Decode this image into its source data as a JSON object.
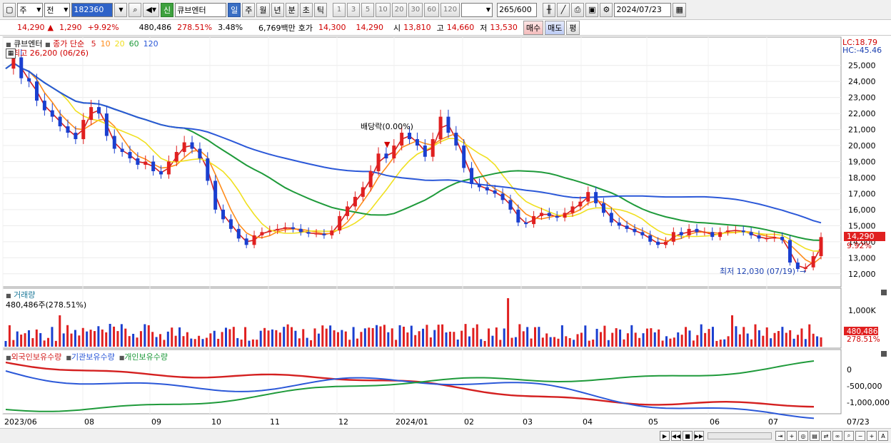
{
  "toolbar": {
    "type_select": "주",
    "prev_label": "전",
    "code_value": "182360",
    "search_icon": "magnifier-icon",
    "credit_badge": "신",
    "stock_name": "큐브엔터",
    "period_tabs": [
      "일",
      "주",
      "월",
      "년",
      "분",
      "초",
      "틱"
    ],
    "active_period": "일",
    "interval_buttons": [
      "1",
      "3",
      "5",
      "10",
      "20",
      "30",
      "60",
      "120"
    ],
    "count_value": "265",
    "count_total": "/600",
    "date_value": "2024/07/23"
  },
  "quote": {
    "price": "14,290",
    "change_arrow": "▲",
    "change": "1,290",
    "change_pct": "+9.92%",
    "volume": "480,486",
    "volume_ratio": "278.51%",
    "turnover": "3.48%",
    "amount": "6,769백만",
    "bid_ask_label": "호가",
    "ask": "14,300",
    "bid": "14,290",
    "open_label": "시",
    "open": "13,810",
    "high_label": "고",
    "high": "14,660",
    "low_label": "저",
    "low": "13,530",
    "buy_button": "매수",
    "sell_button": "매도",
    "eval_button": "평"
  },
  "price_panel": {
    "legend_name": "큐브엔터",
    "legend_close": "종가 단순",
    "ma_labels": [
      "5",
      "10",
      "20",
      "60",
      "120"
    ],
    "ma_colors": [
      "#d42020",
      "#ff8c1a",
      "#f0e020",
      "#1e9a3a",
      "#2b58d8"
    ],
    "high_note": "최고 26,200 (06/26)",
    "low_note": "최저 12,030 (07/19)",
    "dividend_note": "배당락(0.00%)",
    "lc": "LC:18.79",
    "hc": "HC:-45.46",
    "current_price_tag": "14,290",
    "current_pct_tag": "9.92%"
  },
  "volume_panel": {
    "title": "거래량",
    "value": "480,486주(278.51%)",
    "tag_value": "480,486",
    "tag_pct": "278.51%",
    "axis_label": "1,000K"
  },
  "holder_panel": {
    "legend": [
      "외국인보유수량",
      "기관보유수량",
      "개인보유수량"
    ],
    "legend_colors": [
      "#d42020",
      "#2b58d8",
      "#1e9a3a"
    ],
    "axis_labels": [
      "0",
      "-500,000",
      "-1,000,000"
    ]
  },
  "x_axis": {
    "labels": [
      "2023/06",
      "08",
      "09",
      "10",
      "11",
      "12",
      "2024/01",
      "02",
      "03",
      "04",
      "05",
      "06",
      "07"
    ],
    "right_label": "07/23"
  },
  "chart_data": {
    "type": "line",
    "y_axis_labels": [
      "25,000",
      "24,000",
      "23,000",
      "22,000",
      "21,000",
      "20,000",
      "19,000",
      "18,000",
      "17,000",
      "16,000",
      "15,000",
      "14,000",
      "13,000",
      "12,000"
    ],
    "ylim": [
      11500,
      26500
    ],
    "close": [
      24800,
      25500,
      24200,
      24000,
      22800,
      22200,
      21800,
      21200,
      20800,
      20400,
      21600,
      22400,
      22000,
      20600,
      19800,
      19600,
      19200,
      18800,
      19000,
      18400,
      18200,
      19000,
      19600,
      20200,
      19800,
      19200,
      17800,
      16000,
      15400,
      14800,
      14200,
      13800,
      14400,
      14600,
      14700,
      14800,
      14900,
      14800,
      14600,
      14500,
      14500,
      14400,
      14700,
      15600,
      16200,
      16800,
      17400,
      18400,
      19500,
      19200,
      20000,
      20800,
      20400,
      20000,
      19300,
      20400,
      21800,
      20800,
      20000,
      18600,
      17600,
      17400,
      17200,
      17000,
      16600,
      16000,
      15200,
      15100,
      15600,
      15800,
      15600,
      15500,
      15800,
      16200,
      16500,
      17100,
      16400,
      15800,
      15200,
      15000,
      14800,
      14600,
      14400,
      14000,
      13800,
      14000,
      14600,
      14400,
      14800,
      14600,
      14600,
      14300,
      14600,
      14700,
      14700,
      14600,
      14400,
      14200,
      14200,
      14300,
      14100,
      12700,
      12300,
      12400,
      13100,
      14290
    ]
  }
}
